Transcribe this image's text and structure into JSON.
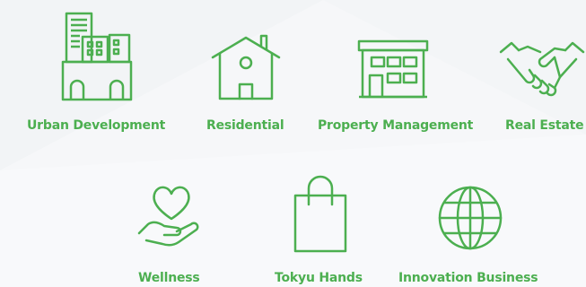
{
  "theme": {
    "accent": "#4caf50",
    "background": "#f6f7f9"
  },
  "categories": [
    {
      "label": "Urban Development",
      "icon": "buildings-icon"
    },
    {
      "label": "Residential",
      "icon": "house-icon"
    },
    {
      "label": "Property Management",
      "icon": "building-management-icon"
    },
    {
      "label": "Real Estate",
      "icon": "handshake-icon"
    },
    {
      "label": "Wellness",
      "icon": "heart-hand-icon"
    },
    {
      "label": "Tokyu Hands",
      "icon": "shopping-bag-icon"
    },
    {
      "label": "Innovation Business",
      "icon": "globe-icon"
    }
  ]
}
